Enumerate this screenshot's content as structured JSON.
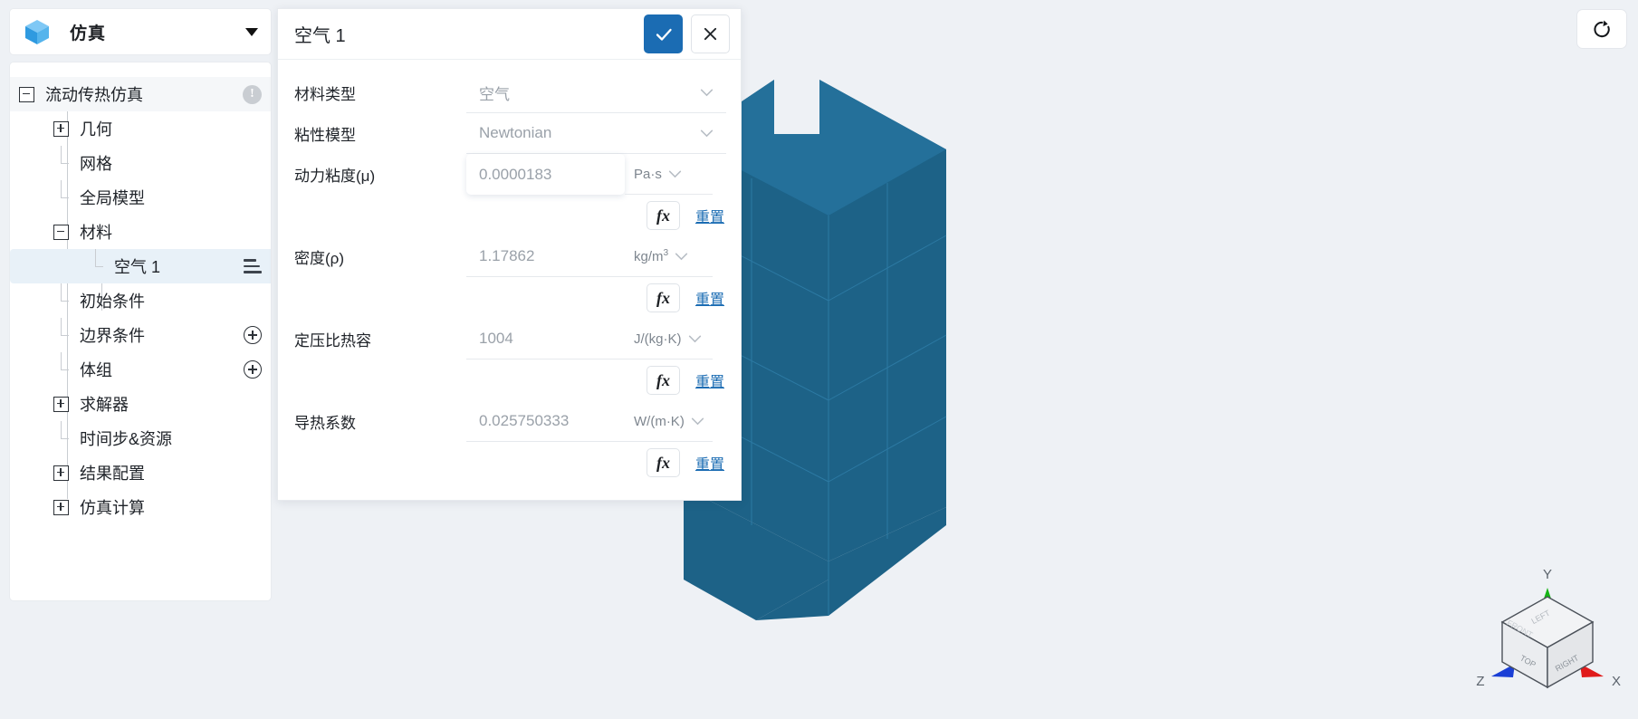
{
  "app": {
    "title": "仿真",
    "logo_icon": "cube-icon",
    "header_caret_icon": "chevron-down-icon"
  },
  "sidebar": {
    "items": [
      {
        "label": "流动传热仿真",
        "depth": 0,
        "toggle": "minus",
        "badge": "warning-icon",
        "selected": true
      },
      {
        "label": "几何",
        "depth": 1,
        "toggle": "plus",
        "badge": "",
        "selected": false
      },
      {
        "label": "网格",
        "depth": 1,
        "toggle": "leaf",
        "badge": "",
        "selected": false
      },
      {
        "label": "全局模型",
        "depth": 1,
        "toggle": "leaf",
        "badge": "",
        "selected": false
      },
      {
        "label": "材料",
        "depth": 1,
        "toggle": "minus",
        "badge": "",
        "selected": false
      },
      {
        "label": "空气 1",
        "depth": 2,
        "toggle": "leaf",
        "badge": "list-icon",
        "selected": true
      },
      {
        "label": "初始条件",
        "depth": 1,
        "toggle": "leaf",
        "badge": "",
        "selected": false
      },
      {
        "label": "边界条件",
        "depth": 1,
        "toggle": "leaf",
        "badge": "plus-circle-icon",
        "selected": false
      },
      {
        "label": "体组",
        "depth": 1,
        "toggle": "leaf",
        "badge": "plus-circle-icon",
        "selected": false
      },
      {
        "label": "求解器",
        "depth": 1,
        "toggle": "plus",
        "badge": "",
        "selected": false
      },
      {
        "label": "时间步&资源",
        "depth": 1,
        "toggle": "leaf",
        "badge": "",
        "selected": false
      },
      {
        "label": "结果配置",
        "depth": 1,
        "toggle": "plus",
        "badge": "",
        "selected": false
      },
      {
        "label": "仿真计算",
        "depth": 1,
        "toggle": "plus",
        "badge": "",
        "selected": false
      }
    ]
  },
  "dialog": {
    "title": "空气 1",
    "confirm_icon": "check-icon",
    "cancel_icon": "close-icon",
    "fx_label": "fx",
    "reset_label": "重置",
    "rows": [
      {
        "label": "材料类型",
        "value": "空气",
        "kind": "select",
        "unit": "",
        "has_fx": false,
        "active": false
      },
      {
        "label": "粘性模型",
        "value": "Newtonian",
        "kind": "select",
        "unit": "",
        "has_fx": false,
        "active": false
      },
      {
        "label": "动力粘度(μ)",
        "value": "0.0000183",
        "kind": "number",
        "unit": "Pa·s",
        "unit_sup": "",
        "has_fx": true,
        "active": true
      },
      {
        "label": "密度(ρ)",
        "value": "1.17862",
        "kind": "number",
        "unit": "kg/m",
        "unit_sup": "3",
        "has_fx": true,
        "active": false
      },
      {
        "label": "定压比热容",
        "value": "1004",
        "kind": "number",
        "unit": "J/(kg·K)",
        "unit_sup": "",
        "has_fx": true,
        "active": false
      },
      {
        "label": "导热系数",
        "value": "0.025750333",
        "kind": "number",
        "unit": "W/(m·K)",
        "unit_sup": "",
        "has_fx": true,
        "active": false
      }
    ]
  },
  "viewport": {
    "reset_view_icon": "refresh-icon",
    "model_color": "#1d6287",
    "axis_labels": {
      "x": "X",
      "y": "Y",
      "z": "Z"
    },
    "cube_faces": {
      "top": "TOP",
      "left": "LEFT",
      "right": "RIGHT",
      "front": "FRONT"
    },
    "axis_colors": {
      "x": "#e01b1b",
      "y": "#15b415",
      "z": "#1a3fd6"
    }
  },
  "colors": {
    "accent": "#1b6cb3",
    "selection": "#e8f1f8",
    "page_bg": "#eef1f5"
  }
}
